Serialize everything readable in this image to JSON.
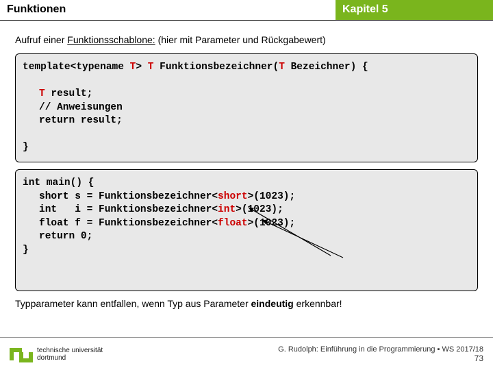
{
  "header": {
    "left": "Funktionen",
    "right": "Kapitel 5"
  },
  "intro": {
    "prefix": "Aufruf einer ",
    "underline": "Funktionsschablone:",
    "suffix": "  (hier mit Parameter und Rückgabewert)"
  },
  "code1": {
    "line1a": "template<typename ",
    "line1b": "T",
    "line1c": "> ",
    "line1d": "T",
    "line1e": " Funktionsbezeichner(",
    "line1f": "T",
    "line1g": " Bezeichner) {",
    "blank1": " ",
    "l2a": "T",
    "l2b": " result;",
    "l3": "// Anweisungen",
    "l4": "return result;",
    "blank2": " ",
    "l5": "}"
  },
  "code2": {
    "l1": "int main() {",
    "l2a": "short s = Funktionsbezeichner<",
    "l2b": "short",
    "l2c": ">(1023);",
    "l3a": "int   i = Funktionsbezeichner<",
    "l3b": "int",
    "l3c": ">(1023);",
    "l4a": "float f = Funktionsbezeichner<",
    "l4b": "float",
    "l4c": ">(1023);",
    "l5": "return 0;",
    "l6": "}"
  },
  "note": {
    "a": "Typparameter kann entfallen, wenn Typ aus Parameter ",
    "b": "eindeutig",
    "c": " erkennbar!"
  },
  "footer": {
    "uni1": "technische universität",
    "uni2": "dortmund",
    "credit": "G. Rudolph: Einführung in die Programmierung ▪ WS 2017/18",
    "page": "73"
  }
}
